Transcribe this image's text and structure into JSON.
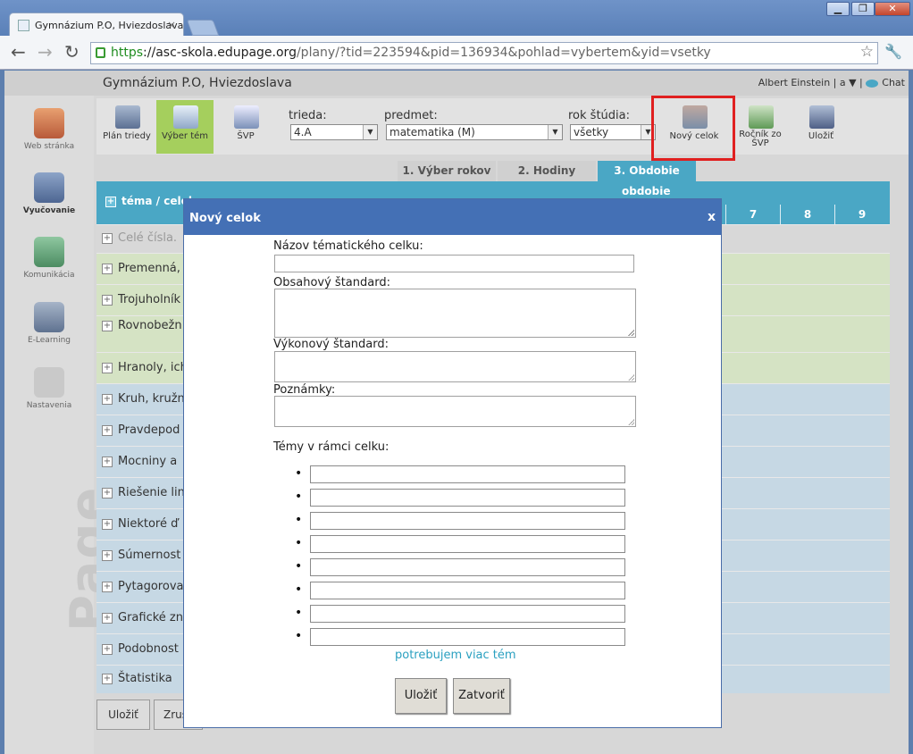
{
  "browser": {
    "tab_title": "Gymnázium P.O, Hviezdoslava",
    "tab_close": "×",
    "url_scheme": "https",
    "url_host": "://asc-skola.edupage.org",
    "url_path": "/plany/?tid=223594&pid=136934&pohlad=vybertem&yid=vsetky",
    "win_min": "▁",
    "win_max": "❐",
    "win_close": "✕",
    "back": "←",
    "forward": "→",
    "reload": "↻",
    "star": "☆",
    "wrench": "🔧"
  },
  "header": {
    "school": "Gymnázium P.O, Hviezdoslava",
    "user": "Albert Einstein | a ▼ |",
    "chat": "Chat"
  },
  "leftnav": {
    "web": "Web stránka",
    "vyucovanie": "Vyučovanie",
    "komunikacia": "Komunikácia",
    "elearning": "E-Learning",
    "nastavenia": "Nastavenia",
    "watermark": "Page"
  },
  "appbar": {
    "plan_triedy": "Plán triedy",
    "vyber_tem": "Výber tém",
    "svp": "ŠVP",
    "novy_celok": "Nový celok",
    "rocnik": "Ročník zo ŠVP",
    "ulozit": "Uložiť",
    "trieda_label": "trieda:",
    "trieda_value": "4.A",
    "predmet_label": "predmet:",
    "predmet_value": "matematika (M)",
    "rok_label": "rok štúdia:",
    "rok_value": "všetky",
    "arrow": "▼"
  },
  "subtabs": {
    "t1": "1. Výber rokov",
    "t2": "2. Hodiny",
    "t3": "3. Obdobie"
  },
  "grid": {
    "col_tema": "téma / celok",
    "col_obdobie": "obdobie",
    "cols": [
      "7",
      "8",
      "9"
    ],
    "rows": [
      "Celé čísla.",
      "Premenná,",
      "Trojuholník",
      "Rovnobežn",
      "Hranoly, ich",
      "Kruh, kružn",
      "Pravdepod",
      "Mocniny a",
      "Riešenie lin",
      "Niektoré ď",
      "Súmernost",
      "Pytagorova",
      "Grafické zn",
      "Podobnost",
      "Štatistika"
    ],
    "plus": "+"
  },
  "bottom": {
    "ulozit": "Uložiť",
    "zrusit": "Zruš"
  },
  "modal": {
    "title": "Nový celok",
    "close": "x",
    "nazov_label": "Názov tématického celku:",
    "obsah_label": "Obsahový štandard:",
    "vykon_label": "Výkonový štandard:",
    "poznamky_label": "Poznámky:",
    "temy_label": "Témy v rámci celku:",
    "bullet": "•",
    "more_link": "potrebujem viac tém",
    "save_button": "Uložiť",
    "close_button": "Zatvoriť"
  }
}
